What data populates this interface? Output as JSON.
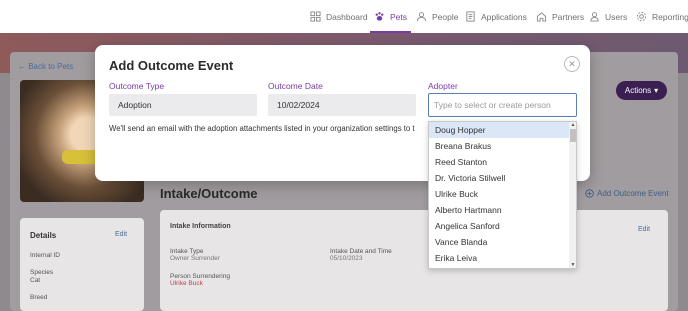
{
  "nav": {
    "items": [
      {
        "label": "Dashboard",
        "icon": "dashboard-icon",
        "active": false
      },
      {
        "label": "Pets",
        "icon": "paw-icon",
        "active": true
      },
      {
        "label": "People",
        "icon": "people-icon",
        "active": false
      },
      {
        "label": "Applications",
        "icon": "applications-icon",
        "active": false
      },
      {
        "label": "Partners",
        "icon": "home-icon",
        "active": false
      },
      {
        "label": "Users",
        "icon": "user-icon",
        "active": false
      },
      {
        "label": "Reporting",
        "icon": "gear-icon",
        "active": false
      }
    ],
    "accent": "#7b3aa6"
  },
  "background": {
    "back_link": "← Back to Pets",
    "actions_label": "Actions",
    "section_title": "Intake/Outcome",
    "add_outcome_label": "Add Outcome Event",
    "details": {
      "title": "Details",
      "edit": "Edit",
      "fields": [
        {
          "label": "Internal ID",
          "value": ""
        },
        {
          "label": "Species",
          "value": "Cat"
        },
        {
          "label": "Breed",
          "value": ""
        }
      ]
    },
    "intake": {
      "title": "Intake Information",
      "edit": "Edit",
      "type_label": "Intake Type",
      "type_value": "Owner Surrender",
      "date_label": "Intake Date and Time",
      "date_value": "05/10/2023",
      "person_label": "Person Surrendering",
      "person_value": "Ulrike Buck"
    }
  },
  "modal": {
    "title": "Add Outcome Event",
    "close_icon": "close-icon",
    "outcome_type": {
      "label": "Outcome Type",
      "value": "Adoption"
    },
    "outcome_date": {
      "label": "Outcome Date",
      "value": "10/02/2024"
    },
    "adopter": {
      "label": "Adopter",
      "placeholder": "Type to select or create person"
    },
    "note": "We'll send an email with the adoption attachments listed in your organization settings to t"
  },
  "adopter_dropdown": {
    "options": [
      "Doug Hopper",
      "Breana Brakus",
      "Reed Stanton",
      "Dr. Victoria Stilwell",
      "Ulrike Buck",
      "Alberto Hartmann",
      "Angelica Sanford",
      "Vance Blanda",
      "Erika Leiva"
    ],
    "highlighted": "Doug Hopper"
  }
}
